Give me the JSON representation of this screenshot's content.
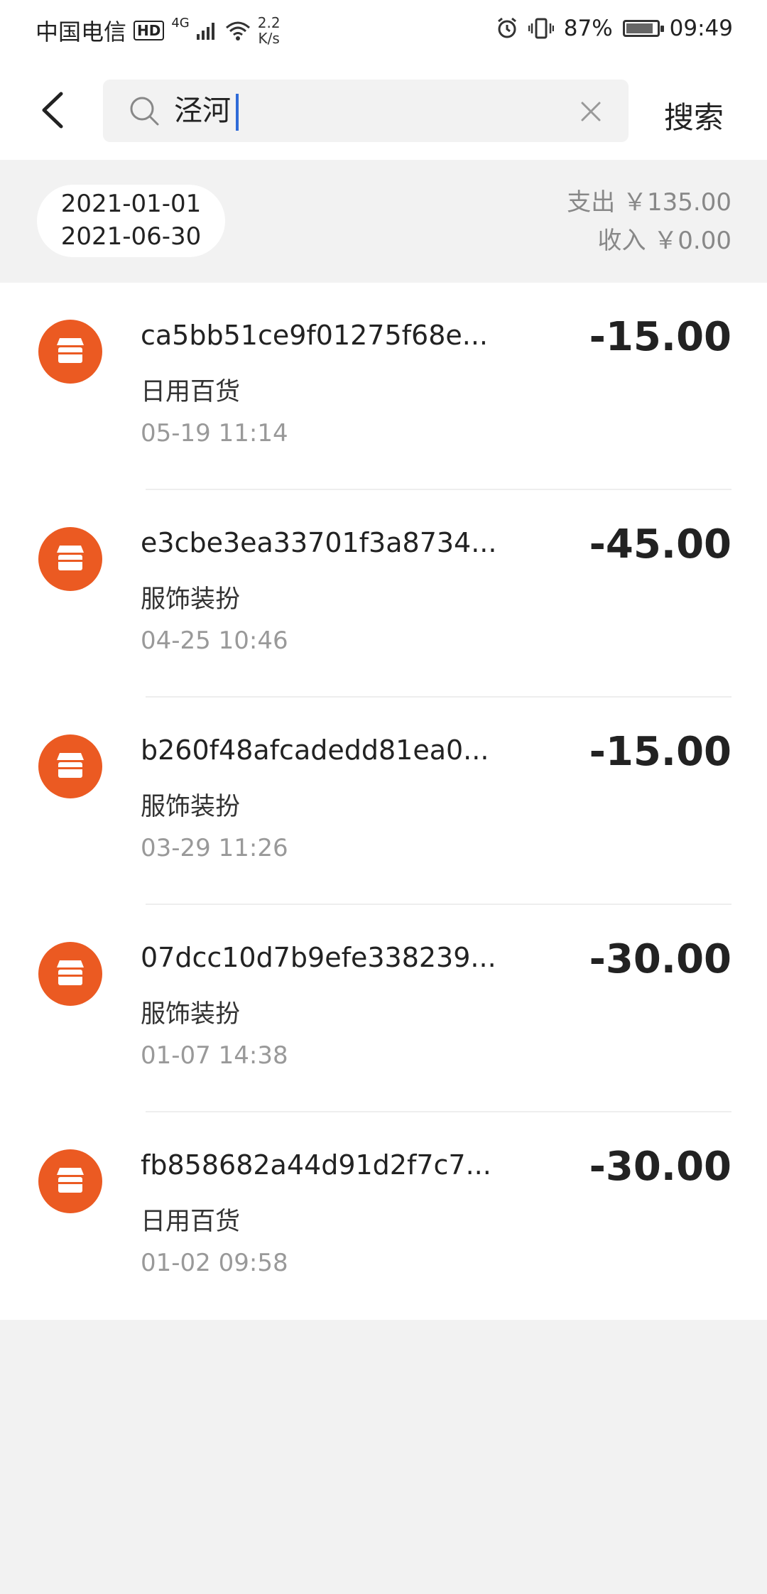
{
  "status_bar": {
    "carrier": "中国电信",
    "hd": "HD",
    "network": "4G",
    "speed_value": "2.2",
    "speed_unit": "K/s",
    "battery": "87%",
    "battery_level": 0.87,
    "time": "09:49"
  },
  "search": {
    "query": "泾河",
    "button_label": "搜索"
  },
  "summary": {
    "start_date": "2021-01-01",
    "end_date": "2021-06-30",
    "expense": "支出 ￥135.00",
    "income": "收入 ￥0.00"
  },
  "transactions": [
    {
      "title": "ca5bb51ce9f01275f68e...",
      "category": "日用百货",
      "time": "05-19  11:14",
      "amount": "-15.00"
    },
    {
      "title": "e3cbe3ea33701f3a8734...",
      "category": "服饰装扮",
      "time": "04-25  10:46",
      "amount": "-45.00"
    },
    {
      "title": "b260f48afcadedd81ea0...",
      "category": "服饰装扮",
      "time": "03-29  11:26",
      "amount": "-15.00"
    },
    {
      "title": "07dcc10d7b9efe338239...",
      "category": "服饰装扮",
      "time": "01-07  14:38",
      "amount": "-30.00"
    },
    {
      "title": "fb858682a44d91d2f7c7...",
      "category": "日用百货",
      "time": "01-02  09:58",
      "amount": "-30.00"
    }
  ],
  "icons": {
    "back": "chevron-left-icon",
    "search": "search-icon",
    "clear": "close-icon",
    "merchant": "store-icon"
  },
  "colors": {
    "accent": "#eb5a22",
    "cursor": "#2f6bd8"
  }
}
